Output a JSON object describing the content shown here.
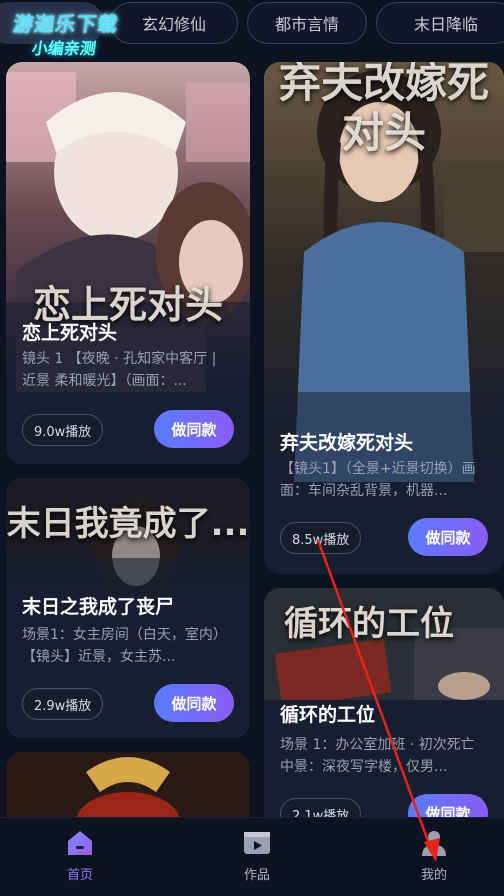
{
  "watermark": {
    "line1": "游迦乐下载",
    "line2": "小编亲测"
  },
  "category_tabs": [
    "玄幻修仙",
    "都市言情",
    "末日降临"
  ],
  "cards": [
    {
      "overlay": "恋上死对头",
      "title": "恋上死对头",
      "desc": "镜头 1 【夜晚 · 孔知家中客厅 | 近景 柔和暖光】（画面：...",
      "plays": "9.0w播放",
      "button": "做同款"
    },
    {
      "overlay": "弃夫改嫁死对头",
      "title": "弃夫改嫁死对头",
      "desc": "【镜头1】（全景+近景切换）画面：车间杂乱背景，机器...",
      "plays": "8.5w播放",
      "button": "做同款"
    },
    {
      "overlay": "末日我竟成了...",
      "title": "末日之我成了丧尸",
      "desc": "场景1：女主房间（白天，室内）【镜头】近景，女主苏...",
      "plays": "2.9w播放",
      "button": "做同款"
    },
    {
      "overlay": "循环的工位",
      "title": "循环的工位",
      "desc": "场景 1：办公室加班 · 初次死亡中景：深夜写字楼，仅男...",
      "plays": "2.1w播放",
      "button": "做同款"
    }
  ],
  "nav": [
    {
      "label": "首页",
      "icon": "home-icon",
      "active": true
    },
    {
      "label": "作品",
      "icon": "video-icon",
      "active": false
    },
    {
      "label": "我的",
      "icon": "user-icon",
      "active": false
    }
  ],
  "colors": {
    "background": "#0d1220",
    "accent": "#8c7bff",
    "button_gradient": [
      "#5a7cff",
      "#8a5cf5"
    ],
    "annotation_arrow": "#e8231b"
  }
}
